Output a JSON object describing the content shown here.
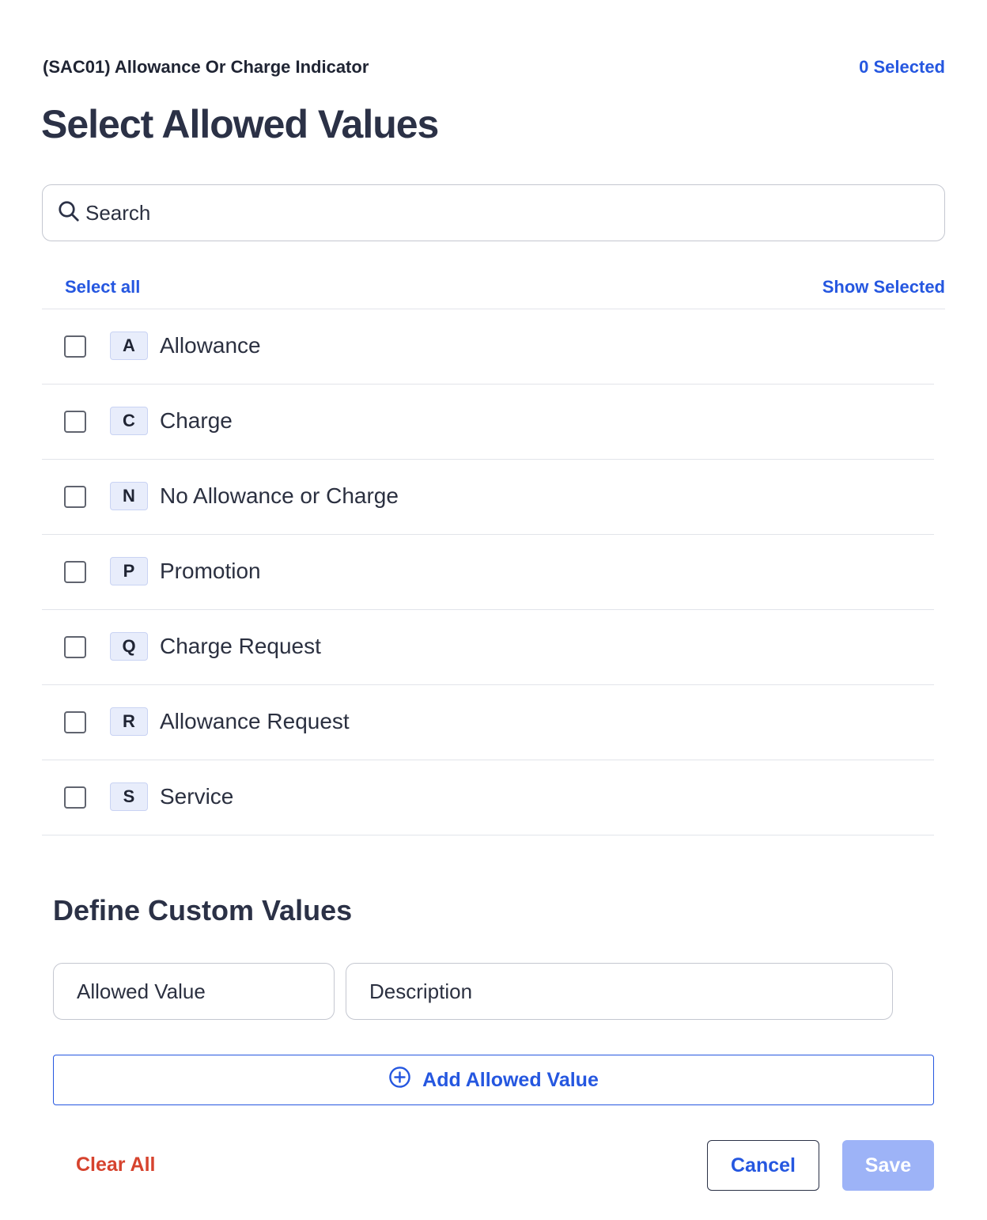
{
  "header": {
    "field_label": "(SAC01) Allowance Or Charge Indicator",
    "selected_count": "0 Selected",
    "title": "Select Allowed Values"
  },
  "search": {
    "placeholder": "Search",
    "value": ""
  },
  "list_actions": {
    "select_all": "Select all",
    "show_selected": "Show Selected"
  },
  "options": [
    {
      "code": "A",
      "label": "Allowance",
      "checked": false
    },
    {
      "code": "C",
      "label": "Charge",
      "checked": false
    },
    {
      "code": "N",
      "label": "No Allowance or Charge",
      "checked": false
    },
    {
      "code": "P",
      "label": "Promotion",
      "checked": false
    },
    {
      "code": "Q",
      "label": "Charge Request",
      "checked": false
    },
    {
      "code": "R",
      "label": "Allowance Request",
      "checked": false
    },
    {
      "code": "S",
      "label": "Service",
      "checked": false
    }
  ],
  "custom_values": {
    "title": "Define Custom Values",
    "allowed_value_placeholder": "Allowed Value",
    "description_placeholder": "Description",
    "add_button": "Add Allowed Value"
  },
  "footer": {
    "clear_all": "Clear All",
    "cancel": "Cancel",
    "save": "Save"
  },
  "colors": {
    "accent": "#2557e0",
    "danger": "#d6432e",
    "save_disabled": "#9db3f7",
    "badge_bg": "#e8edfb"
  },
  "icons": {
    "search": "search-icon",
    "add": "plus-circle-icon"
  }
}
